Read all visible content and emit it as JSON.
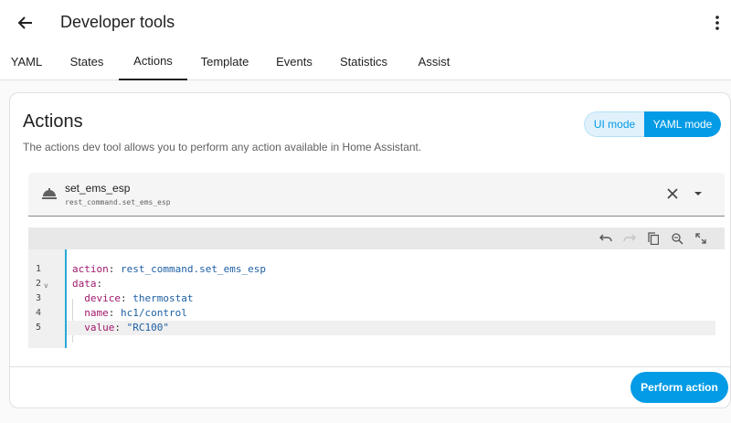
{
  "header": {
    "title": "Developer tools"
  },
  "tabs": [
    {
      "label": "YAML"
    },
    {
      "label": "States"
    },
    {
      "label": "Actions"
    },
    {
      "label": "Template"
    },
    {
      "label": "Events"
    },
    {
      "label": "Statistics"
    },
    {
      "label": "Assist"
    }
  ],
  "active_tab": "Actions",
  "card": {
    "title": "Actions",
    "description": "The actions dev tool allows you to perform any action available in Home Assistant.",
    "mode_ui_label": "UI mode",
    "mode_yaml_label": "YAML mode",
    "selected_mode": "YAML mode"
  },
  "action_picker": {
    "name": "set_ems_esp",
    "id": "rest_command.set_ems_esp"
  },
  "editor": {
    "line_numbers": [
      "1",
      "2",
      "3",
      "4",
      "5"
    ],
    "fold_marker": "v",
    "lines": [
      {
        "key": "action",
        "sep": ": ",
        "value": "rest_command.set_ems_esp"
      },
      {
        "key": "data",
        "sep": ":",
        "value": ""
      },
      {
        "key": "device",
        "sep": ": ",
        "value": "thermostat"
      },
      {
        "key": "name",
        "sep": ": ",
        "value": "hc1/control"
      },
      {
        "key": "value",
        "sep": ": ",
        "value": "\"RC100\""
      }
    ]
  },
  "footer": {
    "perform_label": "Perform action"
  },
  "colors": {
    "accent": "#039be5",
    "yaml_key": "#a0196b",
    "yaml_value": "#1d5fa3"
  }
}
